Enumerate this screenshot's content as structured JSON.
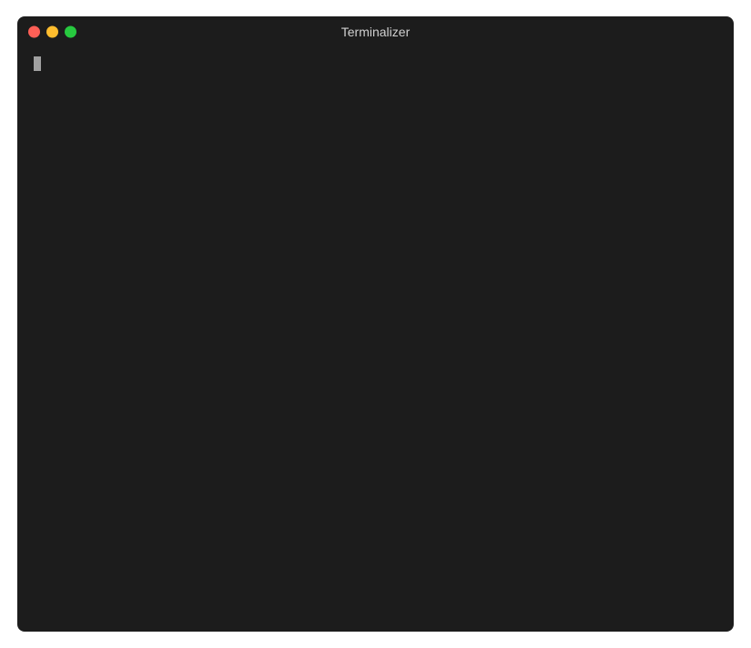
{
  "window": {
    "title": "Terminalizer"
  },
  "traffic_lights": {
    "close_color": "#ff5f56",
    "minimize_color": "#ffbd2e",
    "maximize_color": "#27c93f"
  },
  "terminal": {
    "content": "",
    "cursor_visible": true
  }
}
